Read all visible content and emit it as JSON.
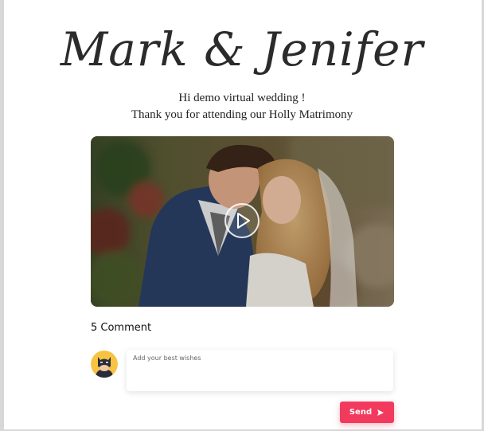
{
  "header": {
    "couple_names": "Mark & Jenifer",
    "greeting_line1": "Hi demo virtual wedding !",
    "greeting_line2": "Thank you for attending our Holly Matrimony"
  },
  "video": {
    "thumbnail": "couple-photo",
    "play_icon": "play-icon"
  },
  "comments": {
    "count_label": "5 Comment",
    "avatar_icon": "batman-avatar-icon",
    "input_placeholder": "Add your best wishes",
    "input_value": "",
    "send_label": "Send",
    "send_icon": "send-arrow-icon"
  },
  "colors": {
    "accent": "#f23a5e",
    "title": "#2b2b2b"
  }
}
